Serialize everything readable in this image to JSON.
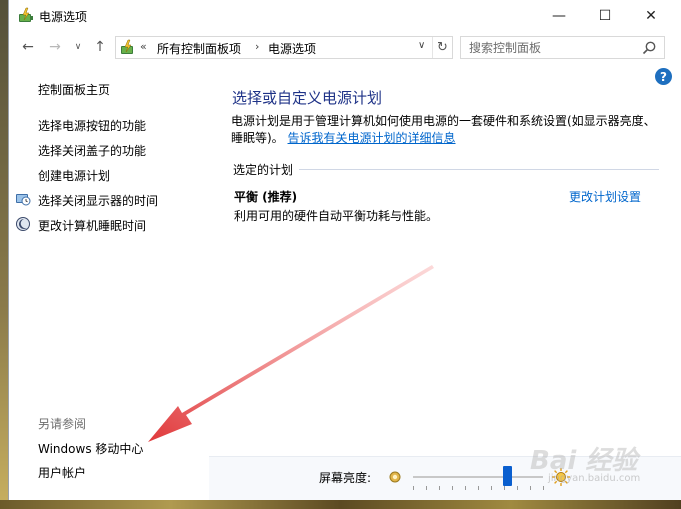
{
  "window": {
    "title": "电源选项",
    "minimize_glyph": "—",
    "maximize_glyph": "☐",
    "close_glyph": "✕"
  },
  "navigation": {
    "back_glyph": "←",
    "forward_glyph": "→",
    "history_glyph": "∨",
    "up_glyph": "↑"
  },
  "address": {
    "overflow": "«",
    "crumbs": [
      "所有控制面板项",
      "电源选项"
    ],
    "separator": "›",
    "dropdown_glyph": "∨",
    "refresh_glyph": "↻"
  },
  "search": {
    "placeholder": "搜索控制面板"
  },
  "sidebar": {
    "home": "控制面板主页",
    "items": [
      {
        "label": "选择电源按钮的功能",
        "icon": "none"
      },
      {
        "label": "选择关闭盖子的功能",
        "icon": "none"
      },
      {
        "label": "创建电源计划",
        "icon": "none"
      },
      {
        "label": "选择关闭显示器的时间",
        "icon": "monitor-clock-icon"
      },
      {
        "label": "更改计算机睡眠时间",
        "icon": "moon-icon"
      }
    ],
    "see_also_heading": "另请参阅",
    "see_also": [
      "Windows 移动中心",
      "用户帐户"
    ]
  },
  "help": {
    "glyph": "?"
  },
  "main": {
    "title": "选择或自定义电源计划",
    "description": "电源计划是用于管理计算机如何使用电源的一套硬件和系统设置(如显示器亮度、睡眠等)。",
    "description_link": "告诉我有关电源计划的详细信息",
    "section_heading": "选定的计划",
    "plan": {
      "name": "平衡 (推荐)",
      "description": "利用可用的硬件自动平衡功耗与性能。",
      "change_link": "更改计划设置"
    }
  },
  "brightness": {
    "label": "屏幕亮度:",
    "level_percent": 73
  },
  "watermark": {
    "text": "Bai 经验",
    "sub": "jingyan.baidu.com"
  },
  "colors": {
    "title_blue": "#1e3287",
    "link_blue": "#0066cc",
    "arrow_red": "#e0393b",
    "slider_blue": "#0a5fcf"
  }
}
